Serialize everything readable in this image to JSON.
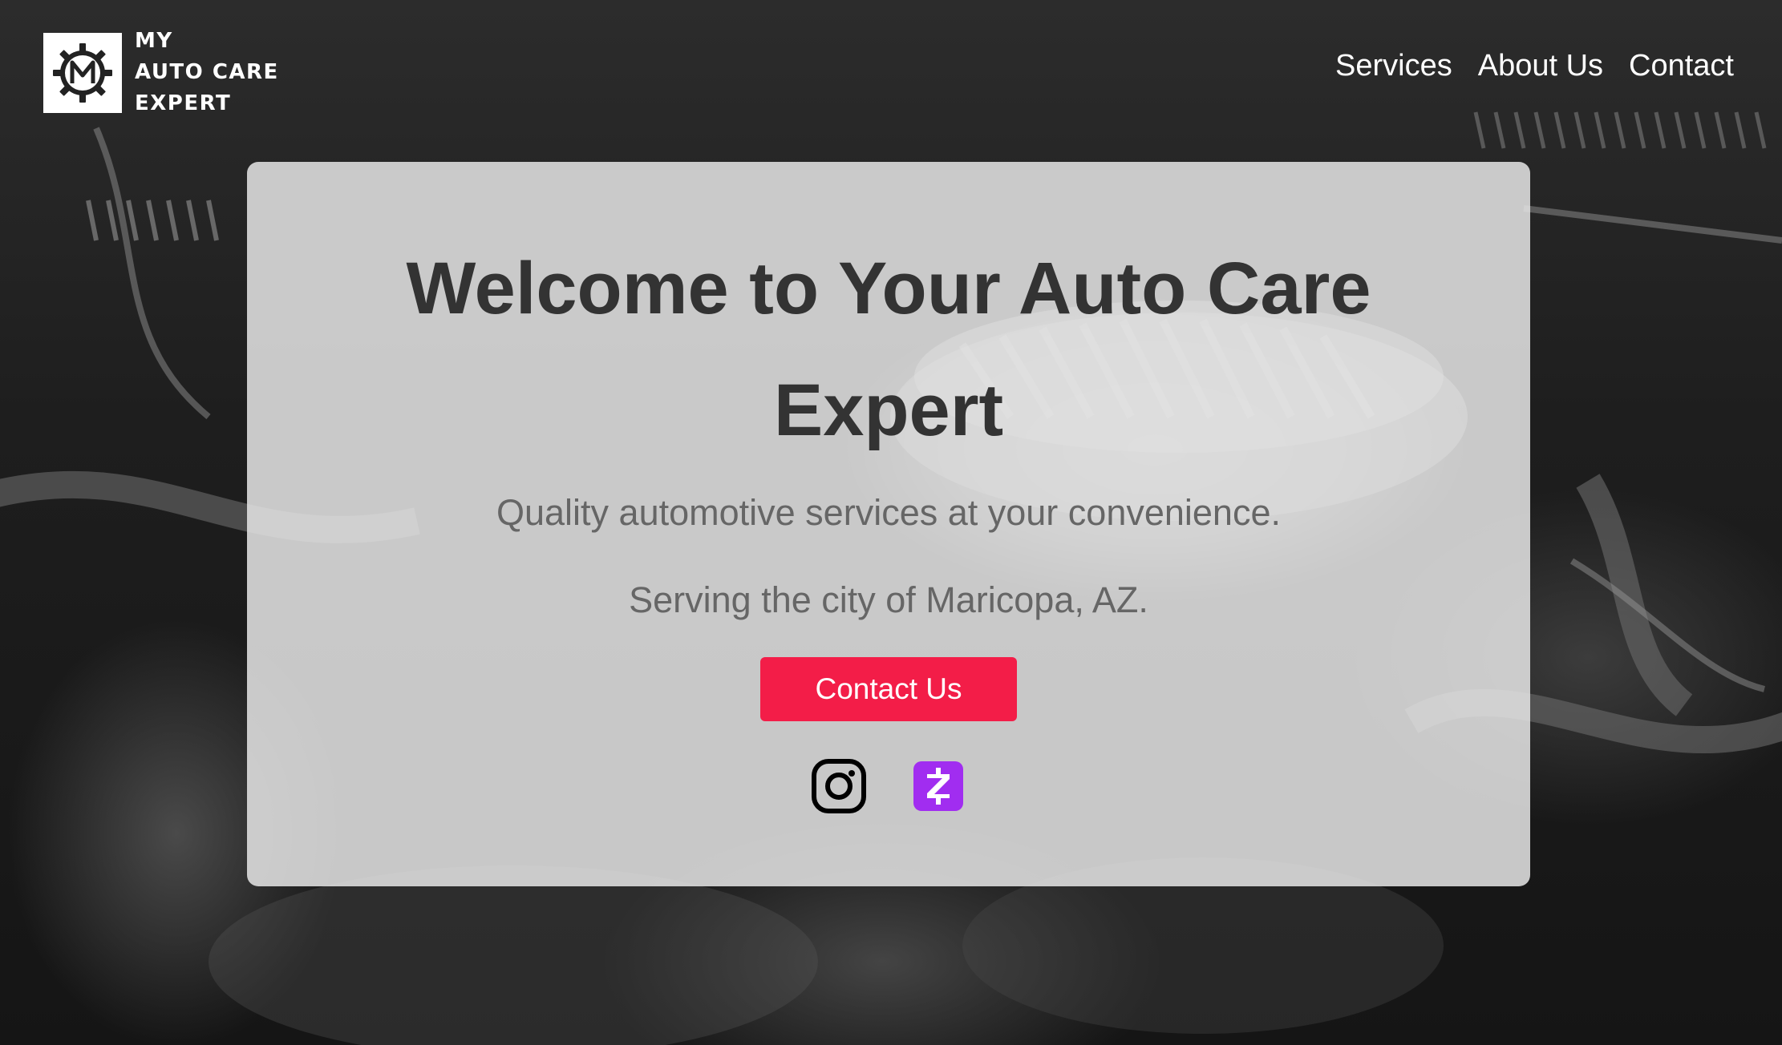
{
  "brand": {
    "logo_icon": "gear-m-logo-icon",
    "name_line1": "MY",
    "name_line2": "AUTO CARE",
    "name_line3": "EXPERT"
  },
  "nav": {
    "items": [
      {
        "label": "Services"
      },
      {
        "label": "About Us"
      },
      {
        "label": "Contact"
      }
    ]
  },
  "hero": {
    "heading": "Welcome to Your Auto Care Expert",
    "tagline": "Quality automotive services at your convenience.",
    "service_area": "Serving the city of Maricopa, AZ.",
    "cta_label": "Contact Us",
    "socials": [
      {
        "icon": "instagram-icon"
      },
      {
        "icon": "zelle-icon"
      }
    ]
  },
  "colors": {
    "accent": "#f31d48",
    "zelle": "#a12df0",
    "heading": "#333333",
    "body_text": "#666666"
  }
}
